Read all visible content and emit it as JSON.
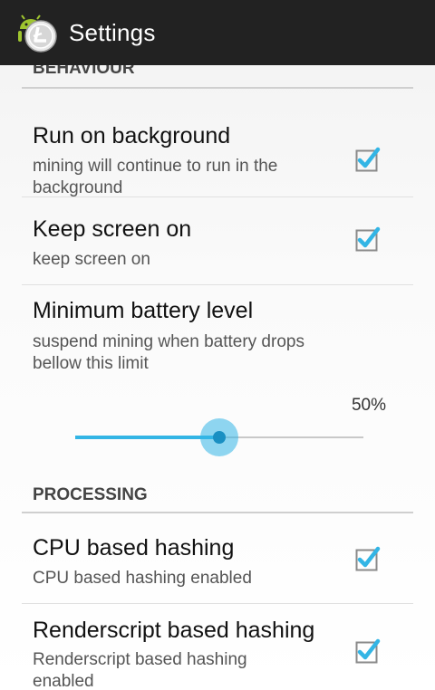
{
  "app_bar": {
    "title": "Settings",
    "icon": "android-litecoin-app-icon"
  },
  "sections": [
    {
      "header": "BEHAVIOUR",
      "items": [
        {
          "title": "Run on background",
          "summary": "mining will continue to run in the background",
          "checked": true
        },
        {
          "title": "Keep screen on",
          "summary": "keep screen on",
          "checked": true
        },
        {
          "title": "Minimum battery level",
          "summary": "suspend mining when battery drops bellow this limit",
          "slider": {
            "value_label": "50%",
            "value": 0.5
          }
        }
      ]
    },
    {
      "header": "PROCESSING",
      "items": [
        {
          "title": "CPU based hashing",
          "summary": "CPU based hashing enabled",
          "checked": true
        },
        {
          "title": "Renderscript based hashing",
          "summary": "Renderscript based hashing enabled",
          "checked": true
        }
      ]
    }
  ],
  "colors": {
    "action_bar": "#222222",
    "accent": "#33b5e5",
    "divider": "#cfcfcf"
  }
}
